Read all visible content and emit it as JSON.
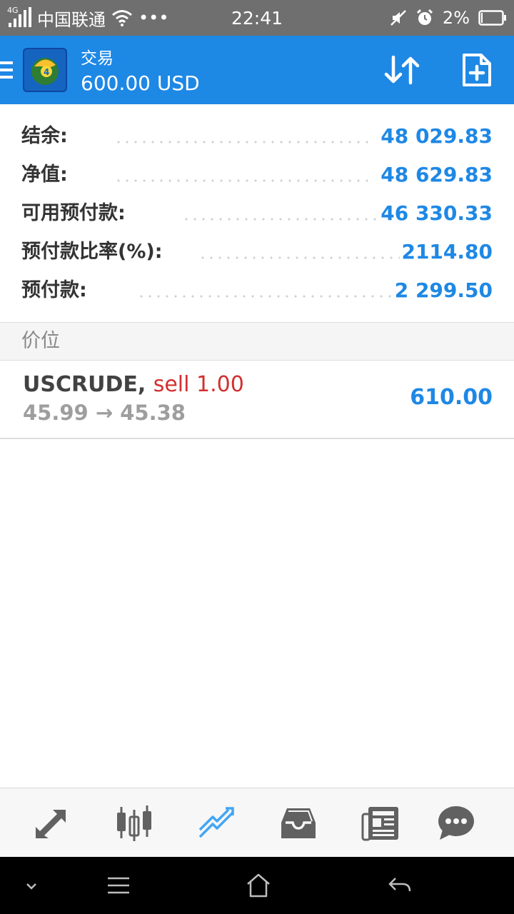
{
  "status_bar": {
    "network_tag": "4G",
    "carrier": "中国联通",
    "more": "•••",
    "time": "22:41",
    "battery": "2%"
  },
  "app_bar": {
    "title": "交易",
    "subtitle": "600.00 USD",
    "icons": {
      "menu": "menu-icon",
      "sort": "sort-icon",
      "add": "add-document-icon"
    }
  },
  "summary": [
    {
      "label": "结余:",
      "value": "48 029.83"
    },
    {
      "label": "净值:",
      "value": "48 629.83"
    },
    {
      "label": "可用预付款:",
      "value": "46 330.33"
    },
    {
      "label": "预付款比率(%):",
      "value": "2114.80"
    },
    {
      "label": "预付款:",
      "value": "2 299.50"
    }
  ],
  "positions_header": "价位",
  "positions": [
    {
      "symbol": "USCRUDE,",
      "side": "sell 1.00",
      "prices": "45.99 → 45.38",
      "profit": "610.00"
    }
  ],
  "bottom_nav": [
    {
      "icon": "quotes-arrows-icon",
      "active": false
    },
    {
      "icon": "chart-candles-icon",
      "active": false
    },
    {
      "icon": "trade-icon",
      "active": true
    },
    {
      "icon": "history-inbox-icon",
      "active": false
    },
    {
      "icon": "news-icon",
      "active": false
    },
    {
      "icon": "chat-icon",
      "active": false
    }
  ],
  "colors": {
    "accent": "#1e88e5",
    "sell": "#d32f2f",
    "status_bar": "#6f6f6f",
    "nav_inactive": "#616161"
  }
}
